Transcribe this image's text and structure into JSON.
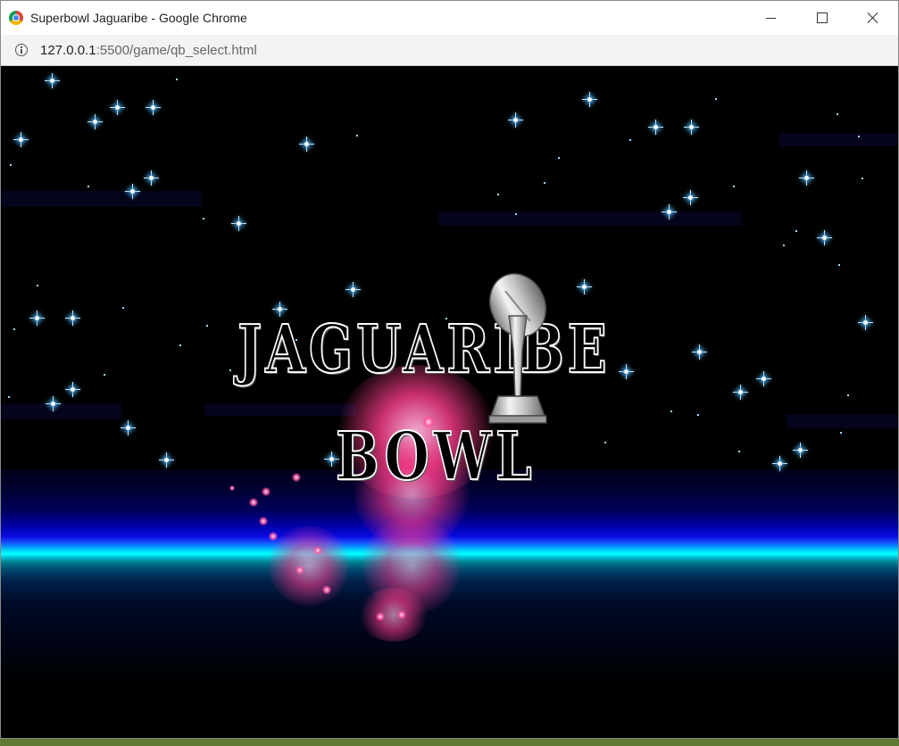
{
  "window": {
    "title": "Superbowl Jaguaribe - Google Chrome",
    "controls": [
      "minimize",
      "maximize",
      "close"
    ]
  },
  "address_bar": {
    "url_host": "127.0.0.1",
    "url_rest": ":5500/game/qb_select.html",
    "security_icon": "info-icon"
  },
  "game": {
    "logo": {
      "line1": "JAGUARIBE",
      "line2": "BOWL",
      "trophy_icon": "trophy-icon"
    },
    "colors": {
      "sky": "#000000",
      "horizon_cyan": "#00ffff",
      "horizon_blue": "#0a0ae0",
      "star": "#4fb6ff",
      "flame": "#ff3c8c"
    }
  }
}
